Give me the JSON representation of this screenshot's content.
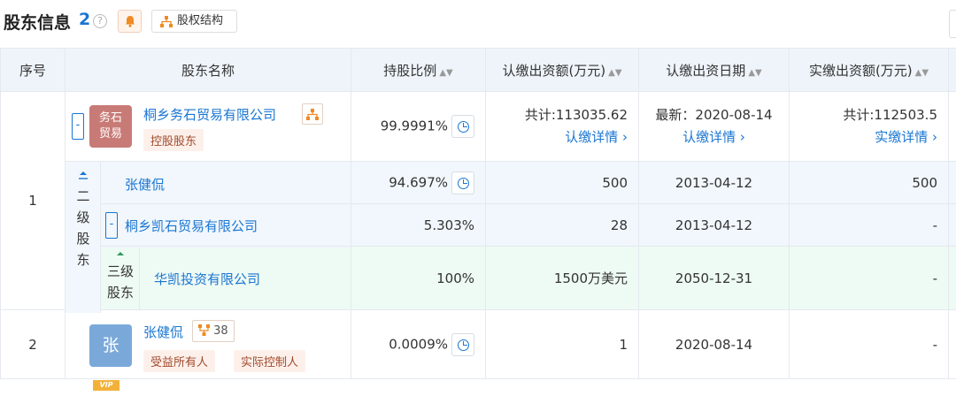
{
  "header": {
    "title": "股东信息",
    "count": "2",
    "help_icon": "?",
    "equity_button": "股权结构"
  },
  "columns": {
    "seq": "序号",
    "name": "股东名称",
    "ratio": "持股比例",
    "subscribed": "认缴出资额(万元)",
    "date": "认缴出资日期",
    "paid": "实缴出资额(万元)"
  },
  "row1": {
    "seq": "1",
    "avatar": "务石贸易",
    "avatar_line1": "务石",
    "avatar_line2": "贸易",
    "avatar_color": "#c87b76",
    "name": "桐乡务石贸易有限公司",
    "tag": "控股股东",
    "ratio": "99.9991%",
    "subscribed": "共计:113035.62",
    "subscribed_link": "认缴详情",
    "date": "最新：2020-08-14",
    "date_link": "认缴详情",
    "paid": "共计:112503.5",
    "paid_link": "实缴详情"
  },
  "level2": {
    "label_chars": [
      "二",
      "级",
      "股",
      "东"
    ],
    "rows": [
      {
        "name": "张健侃",
        "ratio": "94.697%",
        "subscribed": "500",
        "date": "2013-04-12",
        "paid": "500"
      },
      {
        "name": "桐乡凯石贸易有限公司",
        "ratio": "5.303%",
        "subscribed": "28",
        "date": "2013-04-12",
        "paid": "-"
      }
    ]
  },
  "level3": {
    "label_line1": "三级",
    "label_line2": "股东",
    "name": "华凯投资有限公司",
    "ratio": "100%",
    "subscribed": "1500万美元",
    "date": "2050-12-31",
    "paid": "-"
  },
  "row2": {
    "seq": "2",
    "avatar": "张",
    "avatar_color": "#7aa9d9",
    "name": "张健侃",
    "relation_count": "38",
    "tags": [
      "受益所有人",
      "实际控制人"
    ],
    "badge": "VIP",
    "ratio": "0.0009%",
    "subscribed": "1",
    "date": "2020-08-14",
    "paid": "-"
  },
  "colors": {
    "accent": "#1a76d2",
    "tag_bg": "#fdf0ea",
    "tag_text": "#a14a2d",
    "header_bg": "#eef4fa"
  }
}
